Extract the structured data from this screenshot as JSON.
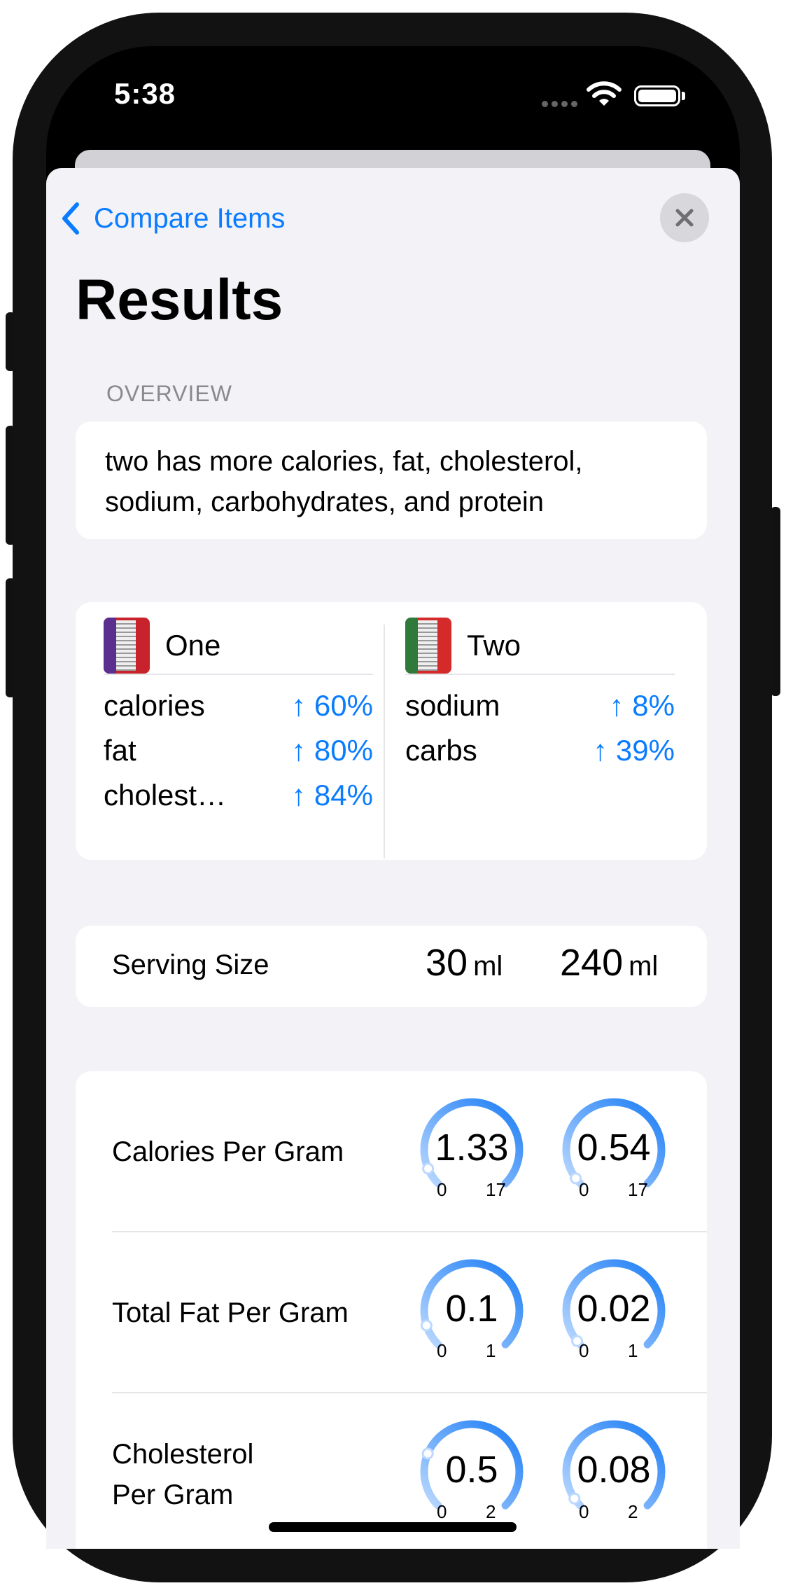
{
  "status_bar": {
    "time": "5:38"
  },
  "nav": {
    "back_label": "Compare Items"
  },
  "page_title": "Results",
  "overview": {
    "header": "OVERVIEW",
    "text": "two has more calories, fat, cholesterol, sodium, carbohydrates, and protein"
  },
  "compare": {
    "items": [
      {
        "name": "One",
        "thumb_color": "#c8232c",
        "rows": [
          {
            "key": "calories",
            "value": "↑ 60%"
          },
          {
            "key": "fat",
            "value": "↑ 80%"
          },
          {
            "key": "cholest…",
            "value": "↑ 84%"
          }
        ]
      },
      {
        "name": "Two",
        "thumb_color": "#d42a2a",
        "rows": [
          {
            "key": "sodium",
            "value": "↑ 8%"
          },
          {
            "key": "carbs",
            "value": "↑ 39%"
          }
        ]
      }
    ]
  },
  "serving": {
    "label": "Serving Size",
    "one": {
      "value": "30",
      "unit": "ml"
    },
    "two": {
      "value": "240",
      "unit": "ml"
    }
  },
  "metrics": [
    {
      "label": "Calories Per Gram",
      "gauges": [
        {
          "value": "1.33",
          "min": "0",
          "max": "17",
          "fraction": 0.08
        },
        {
          "value": "0.54",
          "min": "0",
          "max": "17",
          "fraction": 0.03
        }
      ]
    },
    {
      "label": "Total Fat Per Gram",
      "gauges": [
        {
          "value": "0.1",
          "min": "0",
          "max": "1",
          "fraction": 0.1
        },
        {
          "value": "0.02",
          "min": "0",
          "max": "1",
          "fraction": 0.02
        }
      ]
    },
    {
      "label_line1": "Cholesterol",
      "label_line2": "Per Gram",
      "gauges": [
        {
          "value": "0.5",
          "min": "0",
          "max": "2",
          "fraction": 0.25
        },
        {
          "value": "0.08",
          "min": "0",
          "max": "2",
          "fraction": 0.04
        }
      ]
    }
  ],
  "colors": {
    "accent": "#0a7cff",
    "background": "#f2f2f7",
    "gauge_light": "#bcd9ff",
    "gauge_dark": "#1a7cf5"
  }
}
